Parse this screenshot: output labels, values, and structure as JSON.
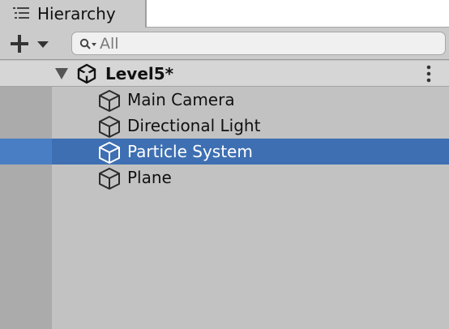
{
  "window": {
    "tab_label": "Hierarchy"
  },
  "toolbar": {
    "search_placeholder": "All"
  },
  "scene": {
    "name": "Level5*"
  },
  "objects": [
    {
      "label": "Main Camera",
      "selected": false
    },
    {
      "label": "Directional Light",
      "selected": false
    },
    {
      "label": "Particle System",
      "selected": true
    },
    {
      "label": "Plane",
      "selected": false
    }
  ],
  "colors": {
    "selection": "#3e6fb2",
    "panel_bg": "#c2c2c2",
    "gutter_bg": "#ababab"
  }
}
